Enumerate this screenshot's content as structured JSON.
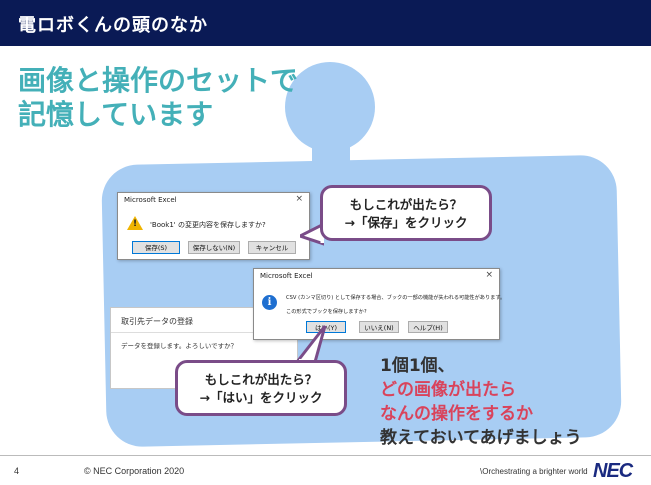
{
  "header": {
    "title": "電ロボくんの頭のなか"
  },
  "heading": {
    "line1": "画像と操作のセットで",
    "line2": "記憶しています"
  },
  "excel_dialog_1": {
    "title": "Microsoft Excel",
    "close": "×",
    "message": "'Book1' の変更内容を保存しますか?",
    "buttons": [
      "保存(S)",
      "保存しない(N)",
      "キャンセル"
    ]
  },
  "excel_dialog_2": {
    "title": "Microsoft Excel",
    "close": "×",
    "message1": "CSV (カンマ区切り) として保存する場合、ブックの一部の機能が失われる可能性があります。",
    "message2": "この形式でブックを保存しますか?",
    "buttons": [
      "はい(Y)",
      "いいえ(N)",
      "ヘルプ(H)"
    ]
  },
  "register_dialog": {
    "title": "取引先データの登録",
    "message": "データを登録します。よろしいですか？"
  },
  "callout_1": {
    "line1": "もしこれが出たら？",
    "line2": "→「保存」をクリック"
  },
  "callout_2": {
    "line1": "もしこれが出たら？",
    "line2": "→「はい」をクリック"
  },
  "body": {
    "line1": "1個1個、",
    "line2": "どの画像が出たら",
    "line3": "なんの操作をするか",
    "line4": "教えておいてあげましょう"
  },
  "footer": {
    "page": "4",
    "copyright": "© NEC Corporation 2020",
    "tagline": "\\Orchestrating a brighter world",
    "logo": "NEC"
  },
  "colors": {
    "header_bg": "#0a1a55",
    "heading": "#44b0b8",
    "accent_red": "#d9435b",
    "blob": "#a8cdf3",
    "callout_border": "#7a4c88"
  }
}
